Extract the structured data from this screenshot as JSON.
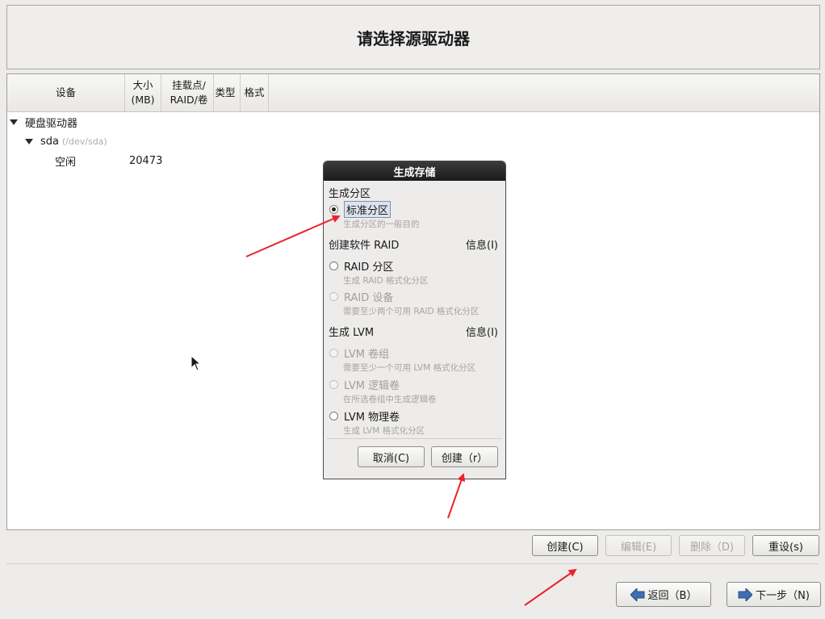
{
  "header": {
    "title": "请选择源驱动器"
  },
  "table": {
    "columns": {
      "device": "设备",
      "size_line1": "大小",
      "size_line2": "(MB)",
      "mount_line1": "挂载点/",
      "mount_line2": "RAID/卷",
      "type": "类型",
      "format": "格式"
    },
    "rows": [
      {
        "label": "硬盘驱动器"
      },
      {
        "label": "sda",
        "path": "(/dev/sda)"
      },
      {
        "label": "空闲",
        "size": "20473"
      }
    ]
  },
  "dialog": {
    "title": "生成存储",
    "section_partition": "生成分区",
    "std_partition": {
      "label": "标准分区",
      "hint": "生成分区的一般目的",
      "selected": true
    },
    "section_raid": "创建软件 RAID",
    "raid_info": "信息(I)",
    "raid_partition": {
      "label": "RAID 分区",
      "hint": "生成 RAID 格式化分区"
    },
    "raid_device": {
      "label": "RAID 设备",
      "hint": "需要至少两个可用 RAID 格式化分区"
    },
    "section_lvm": "生成 LVM",
    "lvm_info": "信息(I)",
    "lvm_vg": {
      "label": "LVM 卷组",
      "hint": "需要至少一个可用 LVM 格式化分区"
    },
    "lvm_lv": {
      "label": "LVM 逻辑卷",
      "hint": "在所选卷组中生成逻辑卷"
    },
    "lvm_pv": {
      "label": "LVM 物理卷",
      "hint": "生成 LVM 格式化分区"
    },
    "cancel": "取消(C)",
    "create": "创建（r）"
  },
  "actions": {
    "create": "创建(C)",
    "edit": "编辑(E)",
    "delete": "删除（D)",
    "reset": "重设(s)"
  },
  "nav": {
    "back": "返回（B）",
    "next": "下一步（N)"
  },
  "colors": {
    "annotation_arrow": "#e8242b",
    "nav_arrow": "#3f6fb0"
  }
}
